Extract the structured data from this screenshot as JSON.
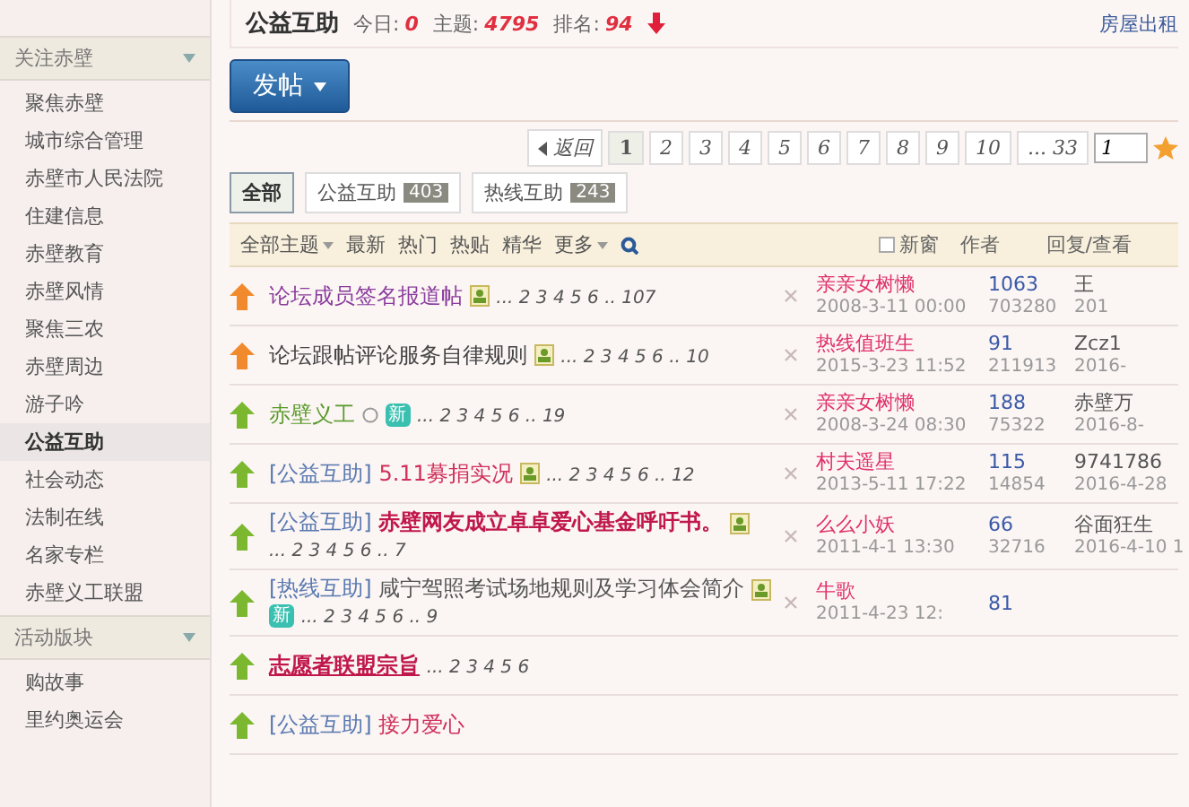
{
  "sidebar": {
    "groups": [
      {
        "title": "关注赤壁",
        "items": [
          {
            "label": "聚焦赤壁",
            "selected": false
          },
          {
            "label": "城市综合管理",
            "selected": false
          },
          {
            "label": "赤壁市人民法院",
            "selected": false
          },
          {
            "label": "住建信息",
            "selected": false
          },
          {
            "label": "赤壁教育",
            "selected": false
          },
          {
            "label": "赤壁风情",
            "selected": false
          },
          {
            "label": "聚焦三农",
            "selected": false
          },
          {
            "label": "赤壁周边",
            "selected": false
          },
          {
            "label": "游子吟",
            "selected": false
          },
          {
            "label": "公益互助",
            "selected": true
          },
          {
            "label": "社会动态",
            "selected": false
          },
          {
            "label": "法制在线",
            "selected": false
          },
          {
            "label": "名家专栏",
            "selected": false
          },
          {
            "label": "赤壁义工联盟",
            "selected": false
          }
        ]
      },
      {
        "title": "活动版块",
        "items": [
          {
            "label": "购故事",
            "selected": false
          },
          {
            "label": "里约奥运会",
            "selected": false
          }
        ]
      }
    ]
  },
  "forum_header": {
    "title": "公益互助",
    "stats": [
      {
        "label": "今日:",
        "value": "0"
      },
      {
        "label": "主题:",
        "value": "4795"
      },
      {
        "label": "排名:",
        "value": "94"
      }
    ],
    "rank_down": true,
    "top_link": "房屋出租"
  },
  "post_button": {
    "label": "发帖"
  },
  "pager": {
    "back": "返回",
    "pages": [
      {
        "label": "1",
        "selected": true
      },
      {
        "label": "2",
        "selected": false
      },
      {
        "label": "3",
        "selected": false
      },
      {
        "label": "4",
        "selected": false
      },
      {
        "label": "5",
        "selected": false
      },
      {
        "label": "6",
        "selected": false
      },
      {
        "label": "7",
        "selected": false
      },
      {
        "label": "8",
        "selected": false
      },
      {
        "label": "9",
        "selected": false
      },
      {
        "label": "10",
        "selected": false
      },
      {
        "label": "... 33",
        "selected": false
      }
    ],
    "jump_value": "1"
  },
  "tabs": [
    {
      "label": "全部",
      "selected": true
    },
    {
      "label": "公益互助",
      "count": "403",
      "selected": false
    },
    {
      "label": "热线互助",
      "count": "243",
      "selected": false
    }
  ],
  "filter_bar": {
    "items": [
      {
        "label": "全部主题",
        "dropdown": true
      },
      {
        "label": "最新",
        "dropdown": false
      },
      {
        "label": "热门",
        "dropdown": false
      },
      {
        "label": "热贴",
        "dropdown": false
      },
      {
        "label": "精华",
        "dropdown": false
      },
      {
        "label": "更多",
        "dropdown": true
      }
    ],
    "new_window": {
      "label": "新窗",
      "checked": false
    },
    "author_header": "作者",
    "counts_header": "回复/查看"
  },
  "threads": [
    {
      "kind": "global_top",
      "title": "论坛成员签名报道帖",
      "color": "#8a3c9c",
      "bold": false,
      "underline": false,
      "attachment": true,
      "circle_icon": false,
      "pages": "... 2 3 4 5 6 .. 107",
      "author": "亲亲女树懒",
      "date": "2008-3-11 00:00",
      "replies": "1063",
      "views": "703280",
      "last_poster": "王",
      "last_date": "201"
    },
    {
      "kind": "global_top",
      "title": "论坛跟帖评论服务自律规则",
      "color": "#444444",
      "bold": false,
      "underline": false,
      "attachment": true,
      "circle_icon": false,
      "pages": "... 2 3 4 5 6 .. 10",
      "author": "热线值班生",
      "date": "2015-3-23 11:52",
      "replies": "91",
      "views": "211913",
      "last_poster": "Zcz1",
      "last_date": "2016-"
    },
    {
      "kind": "top",
      "title": "赤壁义工",
      "color": "#5a9a2a",
      "bold": false,
      "underline": false,
      "attachment": false,
      "circle_icon": true,
      "badge": "新",
      "pages": "... 2 3 4 5 6 .. 19",
      "author": "亲亲女树懒",
      "date": "2008-3-24 08:30",
      "replies": "188",
      "views": "75322",
      "last_poster": "赤壁万",
      "last_date": "2016-8-"
    },
    {
      "kind": "top",
      "category": "[公益互助]",
      "title": "5.11募捐实况",
      "color": "#d0305a",
      "bold": false,
      "underline": false,
      "attachment": true,
      "circle_icon": false,
      "pages": "... 2 3 4 5 6 .. 12",
      "author": "村夫遥星",
      "date": "2013-5-11 17:22",
      "replies": "115",
      "views": "14854",
      "last_poster": "9741786",
      "last_date": "2016-4-28"
    },
    {
      "kind": "top",
      "category": "[公益互助]",
      "title": "赤壁网友成立卓卓爱心基金呼吁书。",
      "color": "#c0184a",
      "bold": true,
      "underline": false,
      "attachment": true,
      "circle_icon": false,
      "pages": "... 2 3 4 5 6 .. 7",
      "author": "么么小妖",
      "date": "2011-4-1 13:30",
      "replies": "66",
      "views": "32716",
      "last_poster": "谷面狂生",
      "last_date": "2016-4-10 1"
    },
    {
      "kind": "top",
      "category": "[热线互助]",
      "title": "咸宁驾照考试场地规则及学习体会简介",
      "color": "#555555",
      "bold": false,
      "underline": false,
      "attachment": true,
      "circle_icon": false,
      "badge": "新",
      "pages": "... 2 3 4 5 6 .. 9",
      "author": "牛歌",
      "date": "2011-4-23 12:",
      "replies": "81"
    },
    {
      "kind": "top",
      "title": "志愿者联盟宗旨",
      "color": "#c0184a",
      "bold": true,
      "underline": true,
      "attachment": false,
      "circle_icon": false,
      "pages": "... 2 3 4 5 6"
    },
    {
      "kind": "top",
      "category": "[公益互助]",
      "title": "接力爱心",
      "color": "#d0305a",
      "bold": false,
      "underline": false,
      "attachment": false,
      "circle_icon": false
    }
  ]
}
